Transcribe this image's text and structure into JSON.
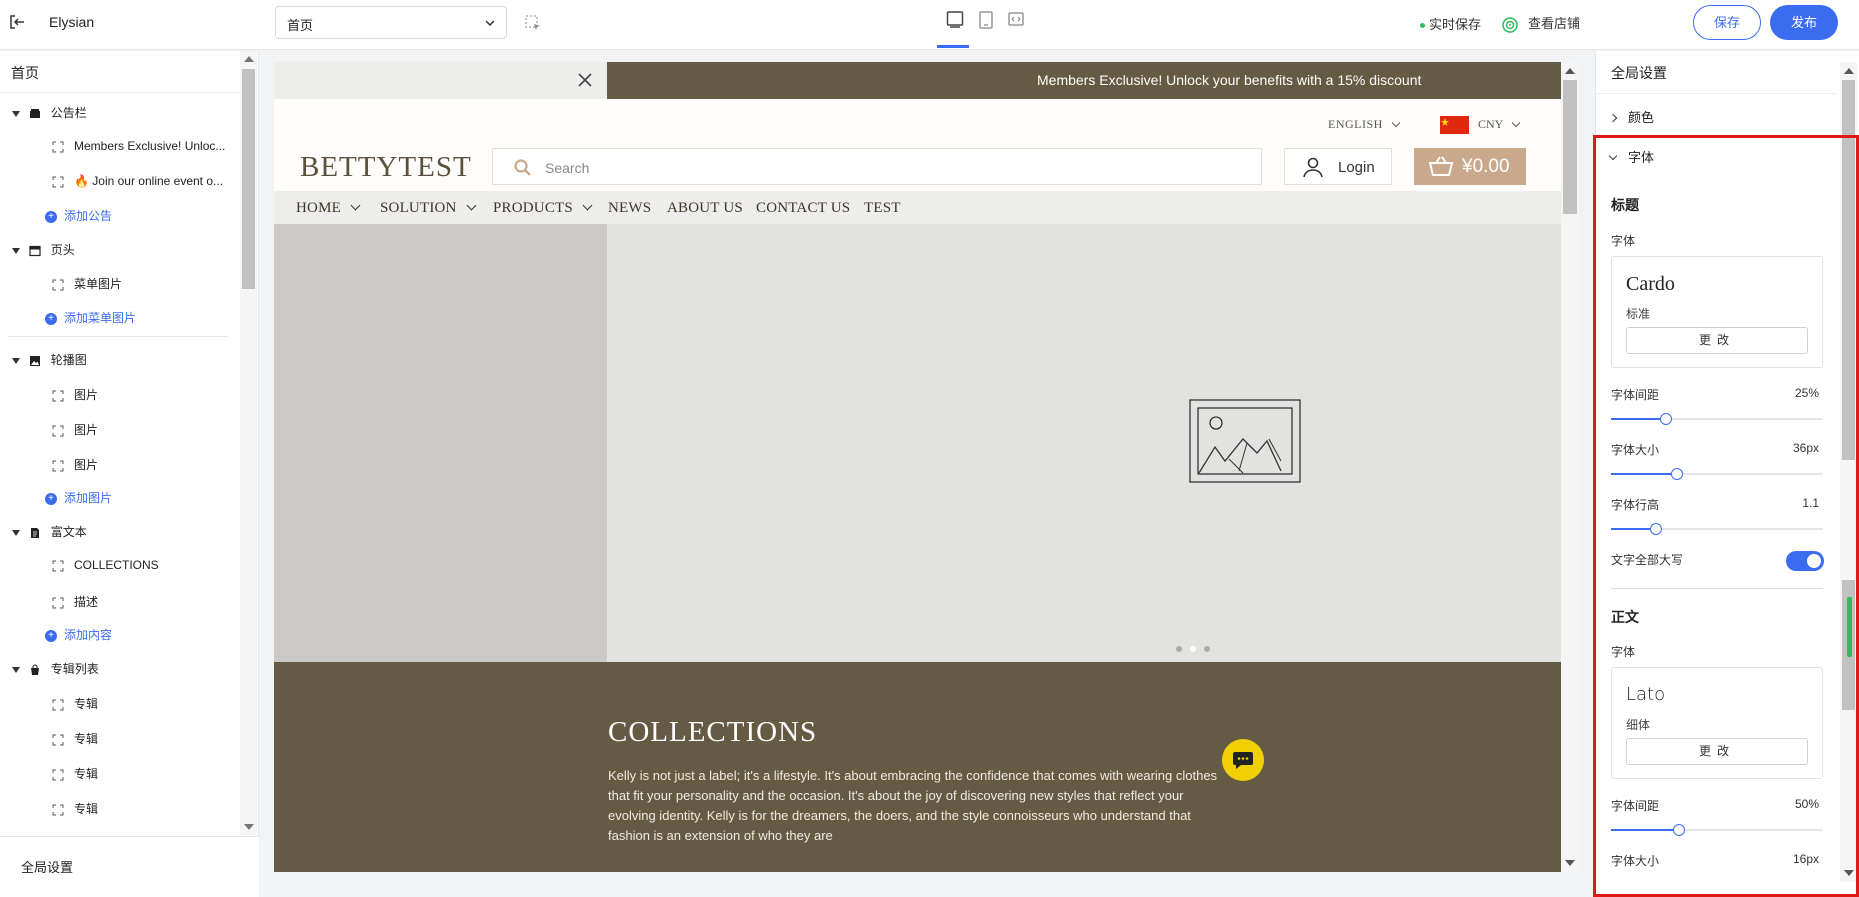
{
  "topbar": {
    "app_name": "Elysian",
    "page_select": "首页",
    "autosave": "实时保存",
    "view_store": "查看店铺",
    "save": "保存",
    "publish": "发布"
  },
  "sidebar": {
    "title": "首页",
    "groups": [
      {
        "label": "公告栏",
        "items": [
          "Members Exclusive! Unloc...",
          "🔥 Join our online event o..."
        ],
        "add": "添加公告"
      },
      {
        "label": "页头",
        "items": [
          "菜单图片"
        ],
        "add": "添加菜单图片"
      },
      {
        "label": "轮播图",
        "items": [
          "图片",
          "图片",
          "图片"
        ],
        "add": "添加图片"
      },
      {
        "label": "富文本",
        "items": [
          "COLLECTIONS",
          "描述"
        ],
        "add": "添加内容"
      },
      {
        "label": "专辑列表",
        "items": [
          "专辑",
          "专辑",
          "专辑",
          "专辑"
        ]
      }
    ],
    "footer": "全局设置"
  },
  "preview": {
    "announcement": "Members Exclusive! Unlock your benefits with a 15% discount",
    "language": "ENGLISH",
    "currency": "CNY",
    "logo": "BETTYTEST",
    "search_placeholder": "Search",
    "login": "Login",
    "cart_total": "¥0.00",
    "nav": [
      "HOME",
      "SOLUTION",
      "PRODUCTS",
      "NEWS",
      "ABOUT US",
      "CONTACT US",
      "TEST"
    ],
    "collections_title": "COLLECTIONS",
    "collections_text": "Kelly is not just a label; it's a lifestyle. It's about embracing the confidence that comes with wearing clothes that fit your personality and the occasion. It's about the joy of discovering new styles that reflect your evolving identity. Kelly is for the dreamers, the doers, and the style connoisseurs who understand that fashion is an extension of who they are"
  },
  "settings": {
    "title": "全局设置",
    "color_section": "颜色",
    "font_section": "字体",
    "heading": {
      "title": "标题",
      "font_label": "字体",
      "font_name": "Cardo",
      "font_style": "标准",
      "change": "更改",
      "letter_spacing_label": "字体间距",
      "letter_spacing": "25%",
      "letter_spacing_level": 0.26,
      "size_label": "字体大小",
      "size": "36px",
      "size_level": 0.31,
      "line_height_label": "字体行高",
      "line_height": "1.1",
      "line_height_level": 0.21,
      "uppercase_label": "文字全部大写",
      "uppercase": true
    },
    "body": {
      "title": "正文",
      "font_label": "字体",
      "font_name": "Lato",
      "font_style": "细体",
      "change": "更改",
      "letter_spacing_label": "字体间距",
      "letter_spacing": "50%",
      "letter_spacing_level": 0.32,
      "size_label": "字体大小",
      "size": "16px"
    }
  },
  "colors": {
    "accent": "#3b6cf0",
    "announcement_bg": "#655a43",
    "cart_bg": "#c9a88c",
    "highlight": "#e01818"
  }
}
